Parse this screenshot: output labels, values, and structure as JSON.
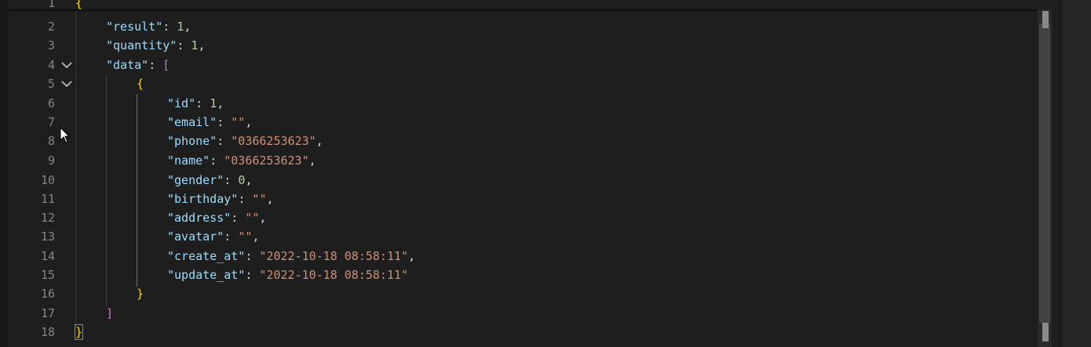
{
  "editor": {
    "lines": [
      {
        "n": "1",
        "text": "{"
      },
      {
        "n": "2",
        "key": "\"result\"",
        "value": "1",
        "vtype": "num",
        "trail": ","
      },
      {
        "n": "3",
        "key": "\"quantity\"",
        "value": "1",
        "vtype": "num",
        "trail": ","
      },
      {
        "n": "4",
        "key": "\"data\"",
        "bracket": "["
      },
      {
        "n": "5",
        "text": "{"
      },
      {
        "n": "6",
        "key": "\"id\"",
        "value": "1",
        "vtype": "num",
        "trail": ","
      },
      {
        "n": "7",
        "key": "\"email\"",
        "value": "\"\"",
        "vtype": "str",
        "trail": ","
      },
      {
        "n": "8",
        "key": "\"phone\"",
        "value": "\"0366253623\"",
        "vtype": "str",
        "trail": ","
      },
      {
        "n": "9",
        "key": "\"name\"",
        "value": "\"0366253623\"",
        "vtype": "str",
        "trail": ","
      },
      {
        "n": "10",
        "key": "\"gender\"",
        "value": "0",
        "vtype": "num",
        "trail": ","
      },
      {
        "n": "11",
        "key": "\"birthday\"",
        "value": "\"\"",
        "vtype": "str",
        "trail": ","
      },
      {
        "n": "12",
        "key": "\"address\"",
        "value": "\"\"",
        "vtype": "str",
        "trail": ","
      },
      {
        "n": "13",
        "key": "\"avatar\"",
        "value": "\"\"",
        "vtype": "str",
        "trail": ","
      },
      {
        "n": "14",
        "key": "\"create_at\"",
        "value": "\"2022-10-18 08:58:11\"",
        "vtype": "str",
        "trail": ","
      },
      {
        "n": "15",
        "key": "\"update_at\"",
        "value": "\"2022-10-18 08:58:11\"",
        "vtype": "str",
        "trail": ""
      },
      {
        "n": "16",
        "text": "}"
      },
      {
        "n": "17",
        "text": "]"
      },
      {
        "n": "18",
        "text": "}"
      }
    ],
    "colors": {
      "background": "#1e1e1e",
      "line_number": "#858585",
      "key": "#9cdcfe",
      "number": "#b5cea8",
      "string": "#ce9178",
      "bracket_level1": "#ffd700",
      "bracket_level2": "#da70d6"
    },
    "fold_icon": "chevron-down-icon",
    "pointer_icon": "mouse-pointer-icon"
  }
}
